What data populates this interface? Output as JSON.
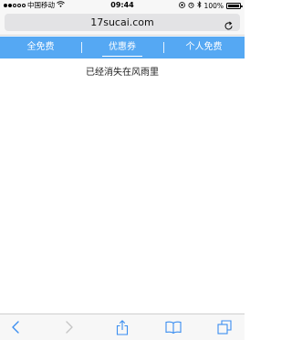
{
  "status_bar": {
    "carrier": "中国移动",
    "time": "09:44",
    "battery_percent": "100%",
    "battery_level": 1.0,
    "signal_bars_filled": 2,
    "signal_bars_total": 5
  },
  "browser": {
    "url": "17sucai.com"
  },
  "tabs": [
    {
      "label": "全免费",
      "active": false
    },
    {
      "label": "优惠券",
      "active": true
    },
    {
      "label": "个人免费",
      "active": false
    }
  ],
  "content": {
    "message": "已经消失在风雨里"
  },
  "colors": {
    "nav_background": "#55a8f3",
    "toolbar_tint": "#3b8ef0",
    "toolbar_disabled": "#c5c5c5"
  },
  "toolbar": {
    "icons": [
      "back-icon",
      "forward-icon",
      "share-icon",
      "bookmarks-icon",
      "tabs-icon"
    ]
  }
}
